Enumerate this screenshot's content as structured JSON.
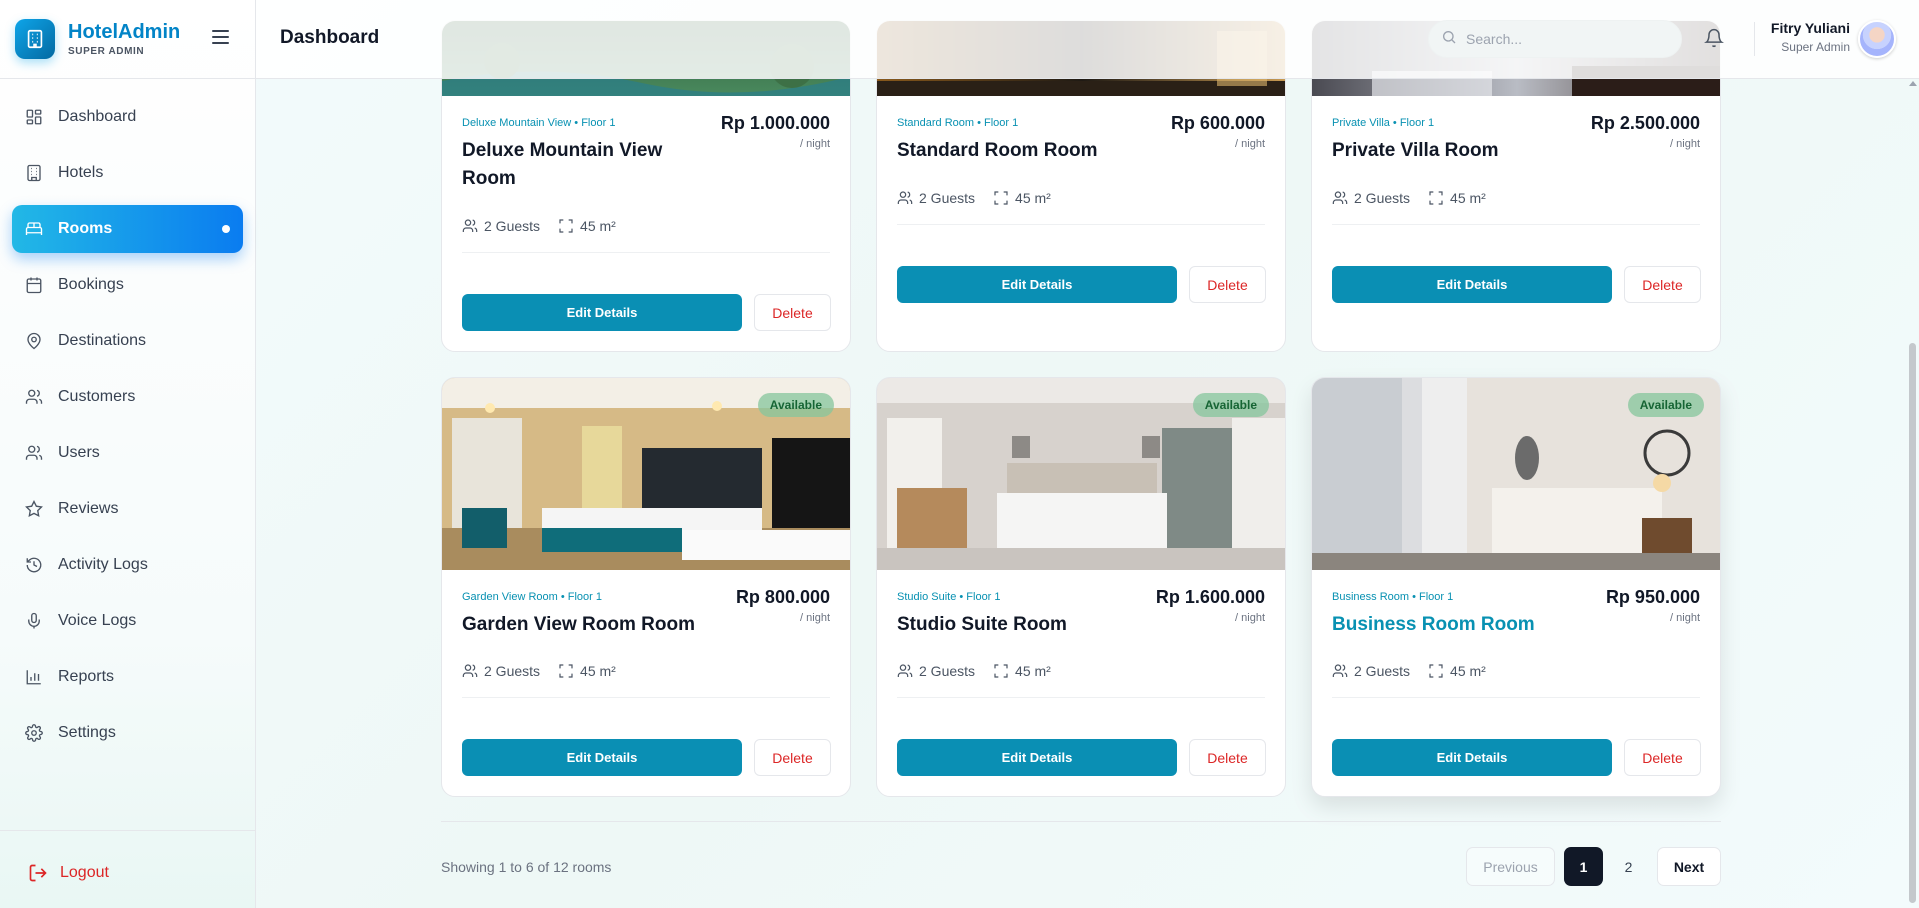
{
  "brand": {
    "name": "HotelAdmin",
    "role": "SUPER ADMIN"
  },
  "sidebar": {
    "items": [
      {
        "label": "Dashboard",
        "icon": "grid-icon"
      },
      {
        "label": "Hotels",
        "icon": "building-icon"
      },
      {
        "label": "Rooms",
        "icon": "bed-icon",
        "active": true
      },
      {
        "label": "Bookings",
        "icon": "calendar-icon"
      },
      {
        "label": "Destinations",
        "icon": "map-pin-icon"
      },
      {
        "label": "Customers",
        "icon": "users-icon"
      },
      {
        "label": "Users",
        "icon": "users-icon"
      },
      {
        "label": "Reviews",
        "icon": "star-icon"
      },
      {
        "label": "Activity Logs",
        "icon": "history-icon"
      },
      {
        "label": "Voice Logs",
        "icon": "mic-icon"
      },
      {
        "label": "Reports",
        "icon": "bar-chart-icon"
      },
      {
        "label": "Settings",
        "icon": "gear-icon"
      }
    ],
    "logout_label": "Logout"
  },
  "header": {
    "title": "Dashboard",
    "search_placeholder": "Search...",
    "user_name": "Fitry Yuliani",
    "user_role": "Super Admin"
  },
  "rooms": [
    {
      "subtitle": "Deluxe Mountain View • Floor 1",
      "name": "Deluxe Mountain View Room",
      "price": "Rp 1.000.000",
      "unit": "/ night",
      "guests": "2 Guests",
      "size": "45 m²",
      "edit": "Edit Details",
      "delete": "Delete"
    },
    {
      "subtitle": "Standard Room • Floor 1",
      "name": "Standard Room Room",
      "price": "Rp 600.000",
      "unit": "/ night",
      "guests": "2 Guests",
      "size": "45 m²",
      "edit": "Edit Details",
      "delete": "Delete"
    },
    {
      "subtitle": "Private Villa • Floor 1",
      "name": "Private Villa Room",
      "price": "Rp 2.500.000",
      "unit": "/ night",
      "guests": "2 Guests",
      "size": "45 m²",
      "edit": "Edit Details",
      "delete": "Delete"
    },
    {
      "subtitle": "Garden View Room • Floor 1",
      "name": "Garden View Room Room",
      "price": "Rp 800.000",
      "unit": "/ night",
      "guests": "2 Guests",
      "size": "45 m²",
      "status": "Available",
      "edit": "Edit Details",
      "delete": "Delete"
    },
    {
      "subtitle": "Studio Suite • Floor 1",
      "name": "Studio Suite Room",
      "price": "Rp 1.600.000",
      "unit": "/ night",
      "guests": "2 Guests",
      "size": "45 m²",
      "status": "Available",
      "edit": "Edit Details",
      "delete": "Delete"
    },
    {
      "subtitle": "Business Room • Floor 1",
      "name": "Business Room Room",
      "price": "Rp 950.000",
      "unit": "/ night",
      "guests": "2 Guests",
      "size": "45 m²",
      "status": "Available",
      "edit": "Edit Details",
      "delete": "Delete"
    }
  ],
  "pagination": {
    "summary": "Showing 1 to 6 of 12 rooms",
    "previous": "Previous",
    "page1": "1",
    "page2": "2",
    "next": "Next"
  }
}
